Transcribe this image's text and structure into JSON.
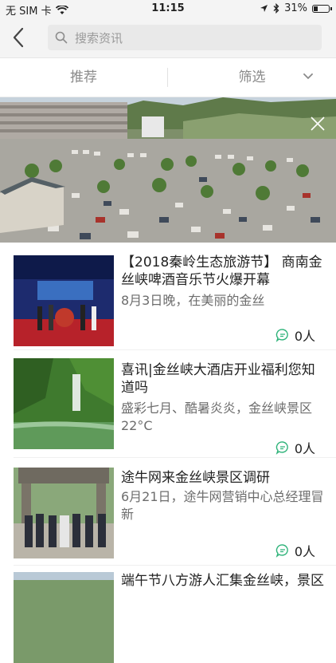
{
  "status_bar": {
    "carrier": "无 SIM 卡",
    "time": "11:15",
    "battery": "31%",
    "battery_level": 0.31
  },
  "search": {
    "placeholder": "搜索资讯"
  },
  "filter": {
    "tab_recommend": "推荐",
    "tab_filter": "筛选"
  },
  "news": [
    {
      "title": "【2018秦岭生态旅游节】 商南金丝峡啤酒音乐节火爆开幕",
      "snippet": "8月3日晚，在美丽的金丝",
      "comments": "0人"
    },
    {
      "title": "喜讯|金丝峡大酒店开业福利您知道吗",
      "snippet": "盛彩七月、酷暑炎炎，金丝峡景区22°C",
      "comments": "0人"
    },
    {
      "title": "途牛网来金丝峡景区调研",
      "snippet": "6月21日，途牛网营销中心总经理冒新",
      "comments": "0人"
    },
    {
      "title": "端午节八方游人汇集金丝峡，景区"
    }
  ]
}
